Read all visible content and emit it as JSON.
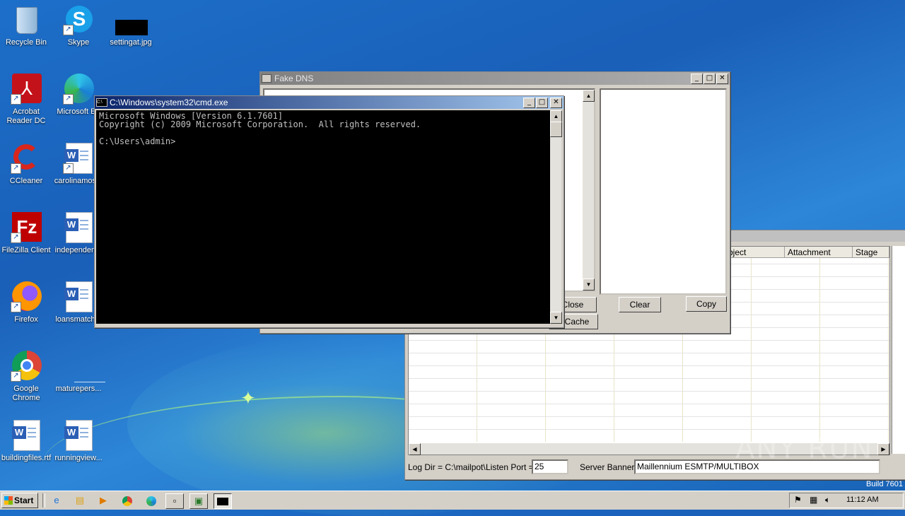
{
  "desktop": {
    "icons": [
      {
        "label": "Recycle Bin",
        "icon": "recycle-bin-icon"
      },
      {
        "label": "Skype",
        "icon": "skype-icon"
      },
      {
        "label": "settingat.jpg",
        "icon": "image-file-icon"
      },
      {
        "label": "Acrobat Reader DC",
        "icon": "acrobat-icon"
      },
      {
        "label": "Microsoft Edge",
        "icon": "edge-icon"
      },
      {
        "label": "CCleaner",
        "icon": "ccleaner-icon"
      },
      {
        "label": "carolinamos...",
        "icon": "word-doc-icon"
      },
      {
        "label": "FileZilla Client",
        "icon": "filezilla-icon"
      },
      {
        "label": "independen...",
        "icon": "word-doc-icon"
      },
      {
        "label": "Firefox",
        "icon": "firefox-icon"
      },
      {
        "label": "loansmatch...",
        "icon": "word-doc-icon"
      },
      {
        "label": "Google Chrome",
        "icon": "chrome-icon"
      },
      {
        "label": "maturepers...",
        "icon": "blank-file-icon"
      },
      {
        "label": "buildingfiles.rtf",
        "icon": "word-doc-icon"
      },
      {
        "label": "runningview...",
        "icon": "word-doc-icon"
      }
    ],
    "watermark": "ANY RUN",
    "build_label": "Build 7601"
  },
  "fake_dns": {
    "title": "Fake DNS",
    "close_label": "Close",
    "cache_label": "h Cache",
    "clear_label": "Clear",
    "copy_label": "Copy"
  },
  "mailpot": {
    "columns": [
      "bject",
      "Attachment",
      "Stage"
    ],
    "log_dir": "Log Dir = C:\\mailpot\\",
    "listen_port_label": "Listen Port =",
    "listen_port_value": "25",
    "server_banner_label": "Server Banner",
    "server_banner_value": "Maillennium ESMTP/MULTIBOX"
  },
  "cmd": {
    "title": "C:\\Windows\\system32\\cmd.exe",
    "line1": "Microsoft Windows [Version 6.1.7601]",
    "line2": "Copyright (c) 2009 Microsoft Corporation.  All rights reserved.",
    "line3": "C:\\Users\\admin>"
  },
  "taskbar": {
    "start_label": "Start",
    "clock": "11:12 AM"
  },
  "colors": {
    "desktop_blue": "#1c6fc9",
    "title_active": "#0a246a",
    "title_inactive": "#808080"
  }
}
